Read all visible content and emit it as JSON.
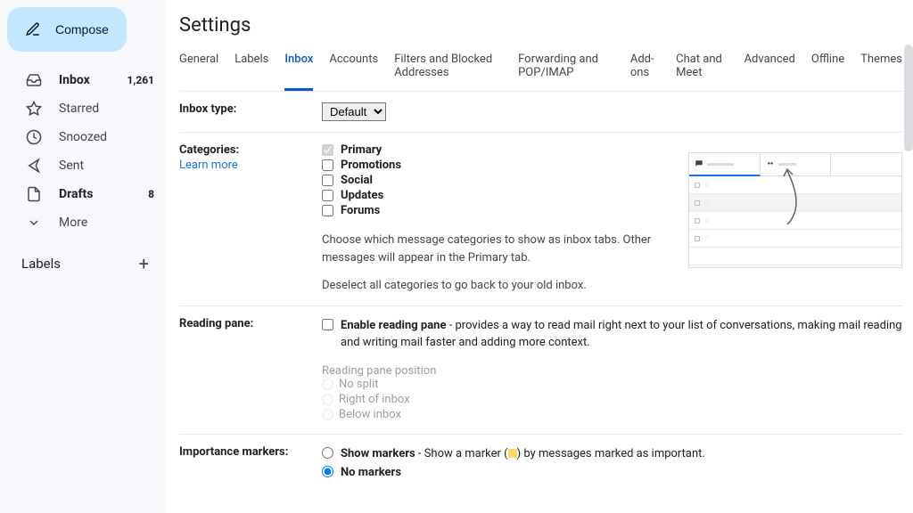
{
  "sidebar": {
    "compose_label": "Compose",
    "items": [
      {
        "label": "Inbox",
        "count": "1,261",
        "icon": "inbox",
        "bold": true
      },
      {
        "label": "Starred",
        "count": "",
        "icon": "star"
      },
      {
        "label": "Snoozed",
        "count": "",
        "icon": "clock"
      },
      {
        "label": "Sent",
        "count": "",
        "icon": "send"
      },
      {
        "label": "Drafts",
        "count": "8",
        "icon": "file",
        "bold": true
      },
      {
        "label": "More",
        "count": "",
        "icon": "chevron-down"
      }
    ],
    "labels_header": "Labels"
  },
  "settings": {
    "title": "Settings",
    "tabs": [
      "General",
      "Labels",
      "Inbox",
      "Accounts",
      "Filters and Blocked Addresses",
      "Forwarding and POP/IMAP",
      "Add-ons",
      "Chat and Meet",
      "Advanced",
      "Offline",
      "Themes"
    ],
    "active_tab": 2
  },
  "inbox_type": {
    "label": "Inbox type:",
    "value": "Default"
  },
  "categories": {
    "label": "Categories:",
    "learn_more": "Learn more",
    "items": [
      {
        "label": "Primary",
        "checked": true,
        "disabled": true,
        "bold": true
      },
      {
        "label": "Promotions",
        "checked": false,
        "bold": true
      },
      {
        "label": "Social",
        "checked": false,
        "bold": true
      },
      {
        "label": "Updates",
        "checked": false,
        "bold": true
      },
      {
        "label": "Forums",
        "checked": false,
        "bold": true
      }
    ],
    "desc1": "Choose which message categories to show as inbox tabs. Other messages will appear in the Primary tab.",
    "desc2": "Deselect all categories to go back to your old inbox."
  },
  "reading_pane": {
    "label": "Reading pane:",
    "enable_label": "Enable reading pane",
    "enable_desc": " - provides a way to read mail right next to your list of conversations, making mail reading and writing mail faster and adding more context.",
    "pos_label": "Reading pane position",
    "positions": [
      "No split",
      "Right of inbox",
      "Below inbox"
    ]
  },
  "importance": {
    "label": "Importance markers:",
    "show_label": "Show markers",
    "show_desc_pre": " - Show a marker (",
    "show_desc_post": ") by messages marked as important.",
    "no_label": "No markers",
    "selected": "no"
  }
}
